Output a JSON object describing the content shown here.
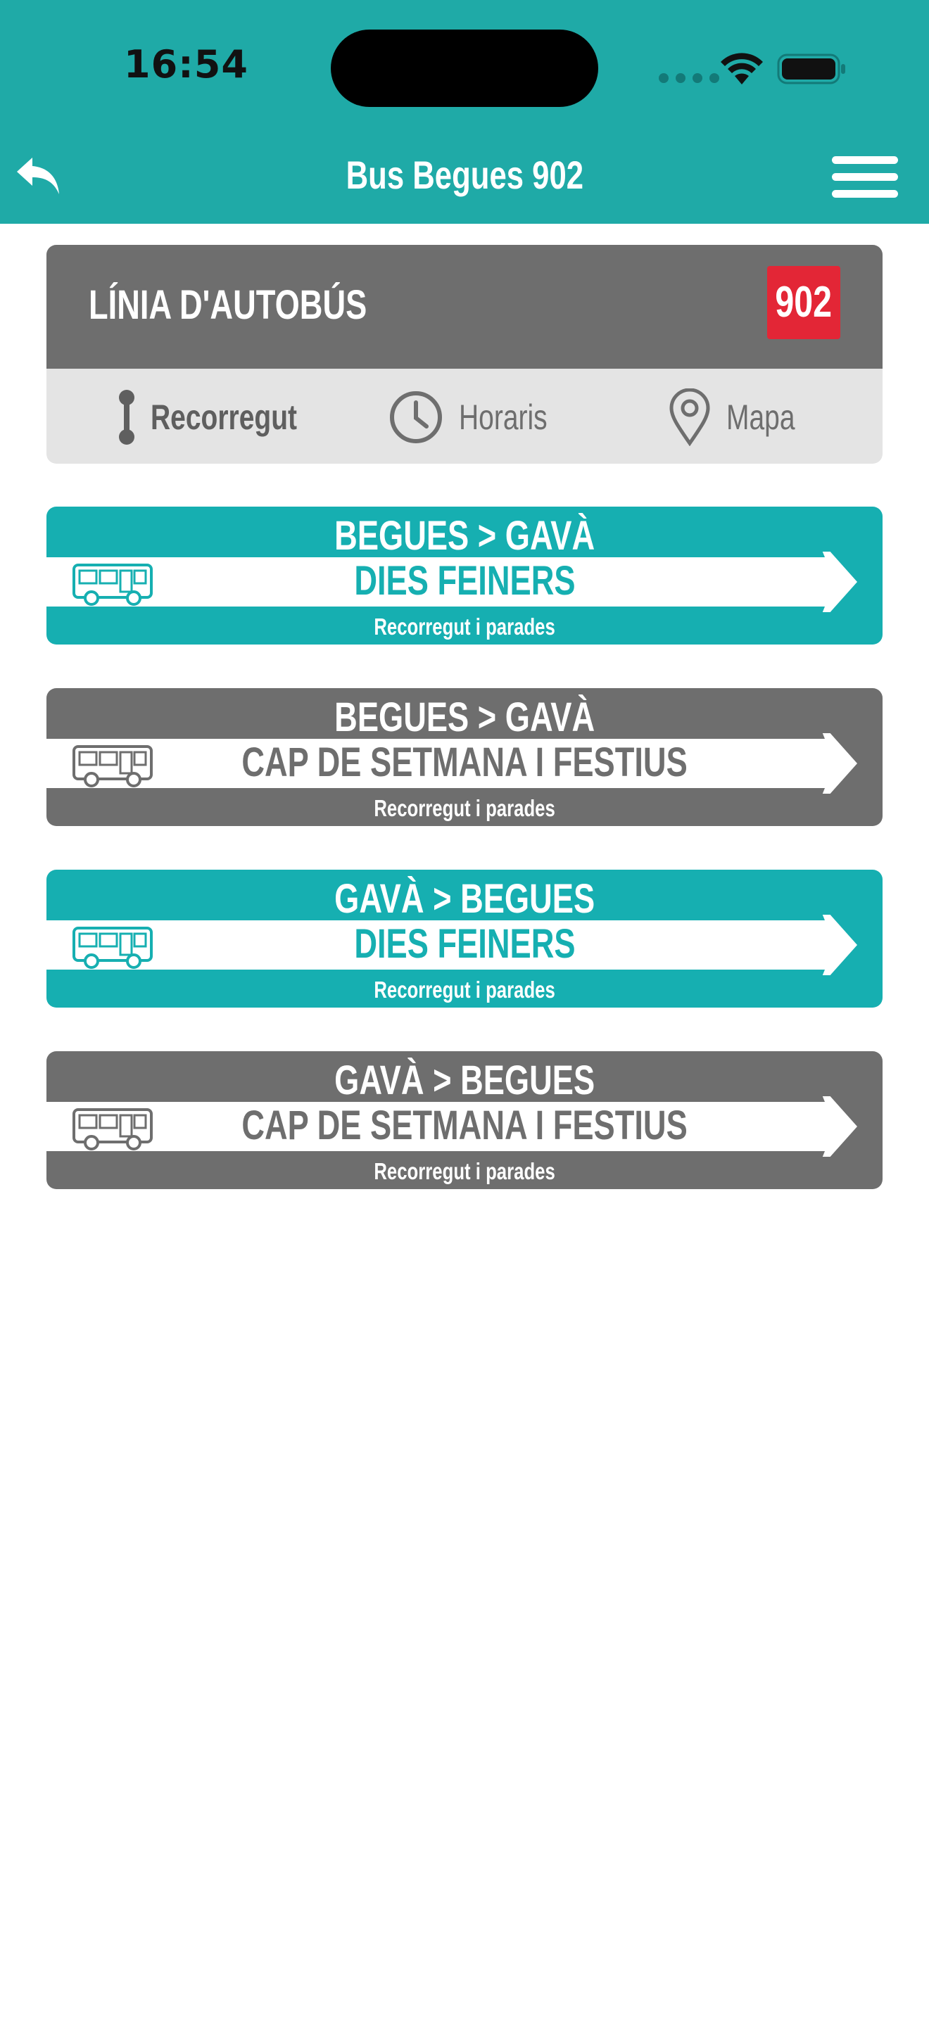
{
  "status_bar": {
    "time": "16:54",
    "icons": [
      "cellular-signal-icon",
      "wifi-icon",
      "battery-icon"
    ]
  },
  "header": {
    "title": "Bus Begues 902",
    "back_icon": "back-arrow-icon",
    "menu_icon": "hamburger-menu-icon",
    "background_color": "#1faaa7"
  },
  "line_card": {
    "label": "LÍNIA D'AUTOBÚS",
    "badge": "902",
    "badge_color": "#e32636",
    "tabs": [
      {
        "label": "Recorregut",
        "icon": "route-line-icon",
        "active": true
      },
      {
        "label": "Horaris",
        "icon": "clock-icon",
        "active": false
      },
      {
        "label": "Mapa",
        "icon": "map-pin-icon",
        "active": false
      }
    ]
  },
  "routes": [
    {
      "direction": "BEGUES > GAVÀ",
      "service": "DIES FEINERS",
      "subtitle": "Recorregut i parades",
      "color": "#16afb1",
      "icon": "bus-icon"
    },
    {
      "direction": "BEGUES > GAVÀ",
      "service": "CAP DE SETMANA I FESTIUS",
      "subtitle": "Recorregut i parades",
      "color": "#6e6e6e",
      "icon": "bus-icon"
    },
    {
      "direction": "GAVÀ > BEGUES",
      "service": "DIES FEINERS",
      "subtitle": "Recorregut i parades",
      "color": "#16afb1",
      "icon": "bus-icon"
    },
    {
      "direction": "GAVÀ > BEGUES",
      "service": "CAP DE SETMANA I FESTIUS",
      "subtitle": "Recorregut i parades",
      "color": "#6e6e6e",
      "icon": "bus-icon"
    }
  ]
}
